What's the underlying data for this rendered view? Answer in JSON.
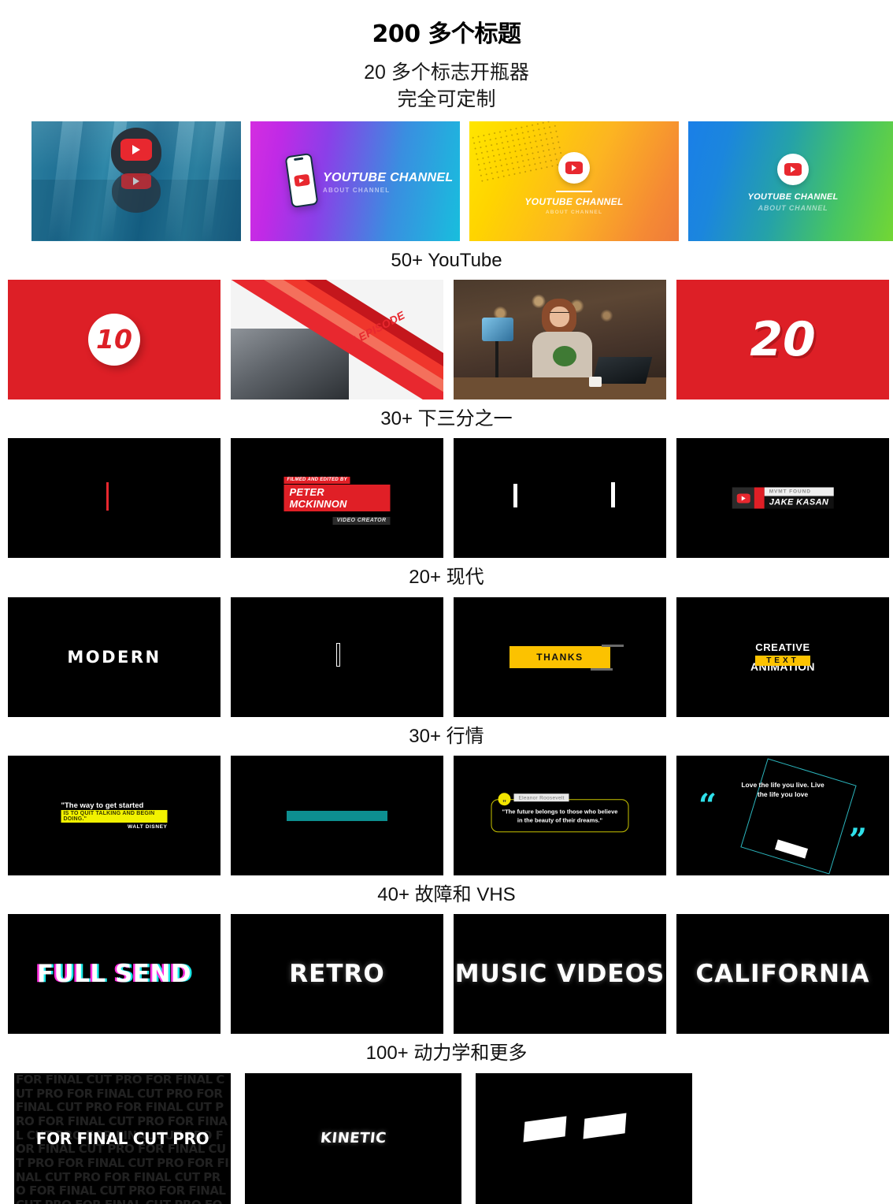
{
  "header": {
    "title": "200 多个标题",
    "subtitle_line1": "20 多个标志开瓶器",
    "subtitle_line2": "完全可定制"
  },
  "colors": {
    "youtube_red": "#e8282f",
    "accent_yellow": "#fcc200",
    "accent_teal": "#0d8f90",
    "accent_cyan": "#2fe0ea",
    "glitch_magenta": "#ff2ee0",
    "glitch_cyan": "#19e8e8",
    "black": "#000000",
    "white": "#ffffff"
  },
  "sections": [
    {
      "heading": "",
      "id": "logo-openers",
      "thumbs": [
        {
          "name": "underwater-logo",
          "style": "water",
          "title": "",
          "subtitle": ""
        },
        {
          "name": "phone-channel",
          "style": "pinkcyan",
          "title": "YOUTUBE CHANNEL",
          "subtitle": "ABOUT CHANNEL"
        },
        {
          "name": "badge-channel-yellow",
          "style": "yelorange",
          "title": "YOUTUBE CHANNEL",
          "subtitle": "ABOUT CHANNEL"
        },
        {
          "name": "badge-channel-green",
          "style": "bluegreen",
          "title": "YOUTUBE CHANNEL",
          "subtitle": "ABOUT CHANNEL"
        }
      ]
    },
    {
      "heading": "50+ YouTube",
      "id": "youtube",
      "thumbs": [
        {
          "name": "count-10",
          "style": "red-number-badge",
          "title": "10",
          "subtitle": ""
        },
        {
          "name": "next-episode",
          "style": "diagonal-stripes",
          "title": "XT EPISODE",
          "subtitle": ""
        },
        {
          "name": "vlogger-cafe",
          "style": "photo-cafe",
          "title": "",
          "subtitle": ""
        },
        {
          "name": "count-20",
          "style": "red-number-big",
          "title": "20",
          "subtitle": ""
        }
      ]
    },
    {
      "heading": "30+ 下三分之一",
      "id": "lower-thirds",
      "thumbs": [
        {
          "name": "red-line-lt",
          "style": "red-line",
          "title": "",
          "subtitle": ""
        },
        {
          "name": "peter-mckinnon-lt",
          "style": "mckinnon",
          "title": "PETER MCKINNON",
          "subtitle": "VIDEO CREATOR",
          "eyebrow": "FILMED AND EDITED BY"
        },
        {
          "name": "white-bars-lt",
          "style": "white-bars",
          "title": "",
          "subtitle": ""
        },
        {
          "name": "jake-kasan-lt",
          "style": "jakekasan",
          "title": "JAKE KASAN",
          "subtitle": "MVMT FOUND"
        }
      ]
    },
    {
      "heading": "20+ 现代",
      "id": "modern",
      "thumbs": [
        {
          "name": "modern-word",
          "style": "modern",
          "title": "MODERN",
          "subtitle": ""
        },
        {
          "name": "thin-bar",
          "style": "thin-bar",
          "title": "",
          "subtitle": ""
        },
        {
          "name": "thanks-bar",
          "style": "thanks",
          "title": "THANKS",
          "subtitle": ""
        },
        {
          "name": "creative-text-animation",
          "style": "creative",
          "title": "CREATIVE",
          "subtitle": "TEXT",
          "third": "ANIMATION"
        }
      ]
    },
    {
      "heading": "30+ 行情",
      "id": "quotes",
      "thumbs": [
        {
          "name": "walt-disney-quote",
          "style": "disney",
          "title": "\"The way to get started",
          "subtitle": "IS TO QUIT TALKING AND BEGIN DOING.\"",
          "third": "WALT DISNEY"
        },
        {
          "name": "teal-bar",
          "style": "teal",
          "title": "",
          "subtitle": ""
        },
        {
          "name": "eleanor-roosevelt-quote",
          "style": "roosevelt",
          "title": "Eleanor Roosevelt",
          "subtitle": "\"The future belongs to those who believe in the beauty of their dreams.\""
        },
        {
          "name": "love-the-life-quote",
          "style": "lovelife",
          "title": "Love the life you live. Live the life you love",
          "subtitle": ""
        }
      ]
    },
    {
      "heading": "40+ 故障和 VHS",
      "id": "glitch-vhs",
      "thumbs": [
        {
          "name": "full-send-glitch",
          "style": "glitch",
          "title": "FULL SEND",
          "subtitle": ""
        },
        {
          "name": "retro-vhs",
          "style": "vhs",
          "title": "RETRO",
          "subtitle": ""
        },
        {
          "name": "music-videos-vhs",
          "style": "vhs",
          "title": "MUSIC VIDEOS",
          "subtitle": ""
        },
        {
          "name": "california-vhs",
          "style": "vhs",
          "title": "CALIFORNIA",
          "subtitle": ""
        }
      ]
    },
    {
      "heading": "100+ 动力学和更多",
      "id": "kinetic",
      "thumbs": [
        {
          "name": "for-final-cut-pro",
          "style": "fcp",
          "title": "FOR FINAL CUT PRO",
          "subtitle": "FOR FINAL CUT PRO"
        },
        {
          "name": "kinetic-word",
          "style": "kinetic",
          "title": "KINETIC",
          "subtitle": ""
        },
        {
          "name": "parallelograms",
          "style": "parallelogram",
          "title": "",
          "subtitle": ""
        }
      ]
    }
  ]
}
